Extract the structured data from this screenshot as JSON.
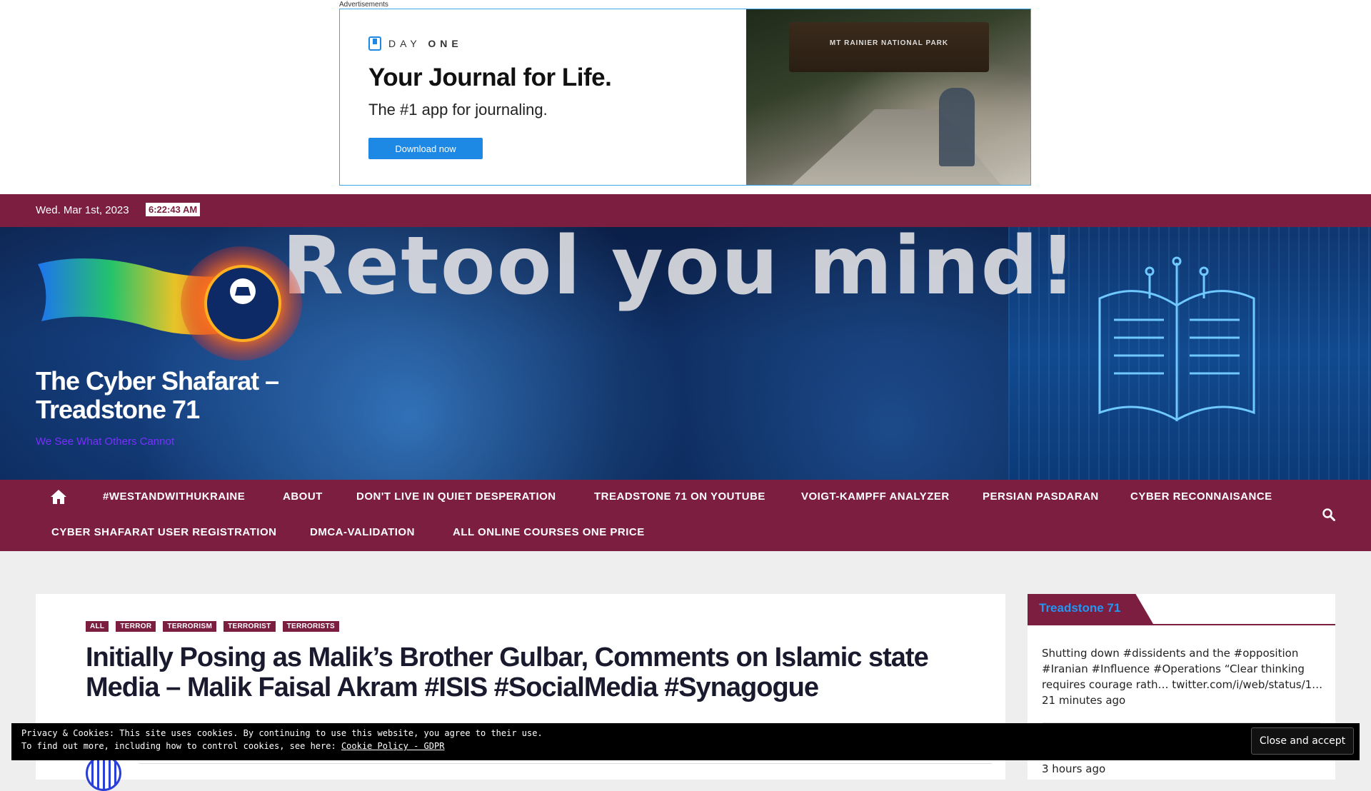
{
  "ad": {
    "label": "Advertisements",
    "brand_prefix": "DAY",
    "brand_suffix": "ONE",
    "headline": "Your Journal for Life.",
    "subline": "The #1 app for journaling.",
    "cta": "Download now",
    "photo_sign": "MT RAINIER NATIONAL PARK",
    "accent_color": "#1e88e5"
  },
  "topbar": {
    "date": "Wed. Mar 1st, 2023",
    "time": "6:22:43 AM"
  },
  "header": {
    "slogan": "Retool you mind!",
    "logo_text": "Treadstone 71",
    "site_title": "The Cyber Shafarat – Treadstone 71",
    "tagline": "We See What Others Cannot"
  },
  "nav": {
    "home_icon": "home-icon",
    "search_icon": "search-icon",
    "items": [
      "#WESTANDWITHUKRAINE",
      "ABOUT",
      "DON'T LIVE IN QUIET DESPERATION",
      "TREADSTONE 71 ON YOUTUBE",
      "VOIGT-KAMPFF ANALYZER",
      "PERSIAN PASDARAN",
      "CYBER RECONNAISANCE",
      "CYBER SHAFARAT USER REGISTRATION",
      "DMCA-VALIDATION",
      "ALL ONLINE COURSES ONE PRICE"
    ]
  },
  "article": {
    "tags": [
      "ALL",
      "TERROR",
      "TERRORISM",
      "TERRORIST",
      "TERRORISTS"
    ],
    "title": "Initially Posing as Malik’s Brother Gulbar, Comments on Islamic state Media – Malik Faisal Akram #ISIS #SocialMedia #Synagogue"
  },
  "sidebar": {
    "widget_title": "Treadstone 71",
    "tweet1": "Shutting down #dissidents and the #opposition #Iranian #Influence #Operations “Clear thinking requires courage rath… twitter.com/i/web/status/1… 21 minutes ago",
    "tweet2_time": "3 hours ago"
  },
  "cookie": {
    "line1": "Privacy & Cookies: This site uses cookies. By continuing to use this website, you agree to their use.",
    "line2_prefix": "To find out more, including how to control cookies, see here: ",
    "link": "Cookie Policy - GDPR",
    "close": "Close and accept"
  },
  "colors": {
    "brand": "#7b1e3f",
    "tagline": "#7a2fff",
    "widget_title": "#2196f3"
  }
}
